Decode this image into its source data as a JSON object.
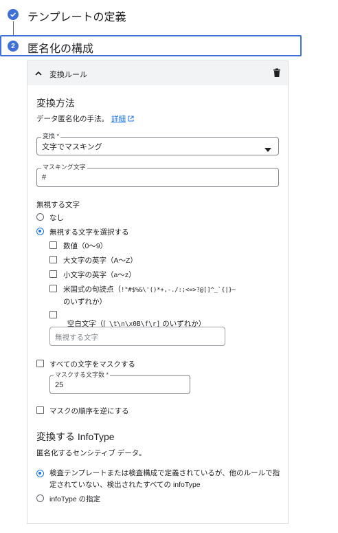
{
  "stepper": {
    "step1": {
      "title": "テンプレートの定義"
    },
    "step2": {
      "number": "2",
      "title": "匿名化の構成"
    }
  },
  "rule_card": {
    "header_label": "変換ルール",
    "transform_method": {
      "title": "変換方法",
      "description": "データ匿名化の手法。",
      "details_link": "詳細"
    },
    "transform_select": {
      "label": "変換 *",
      "value": "文字でマスキング"
    },
    "masking_char_field": {
      "label": "マスキング文字",
      "value": "#"
    },
    "ignore_chars": {
      "title": "無視する文字",
      "options": [
        {
          "label": "なし",
          "selected": false
        },
        {
          "label": "無視する文字を選択する",
          "selected": true
        }
      ],
      "checkboxes": [
        {
          "label": "数値（0〜9）",
          "checked": false
        },
        {
          "label": "大文字の英字（A〜Z）",
          "checked": false
        },
        {
          "label": "小文字の英字（a〜z）",
          "checked": false
        },
        {
          "label_prefix": "米国式の句読点（",
          "label_code": "!\"#$%&\\'()*+,-./:;<=>?@[]^_`{|}~",
          "label_suffix": "のいずれか）",
          "checked": false
        },
        {
          "label_prefix": "空白文字（[",
          "label_code": " \\t\\n\\x0B\\f\\r]",
          "label_suffix": " のいずれか）",
          "checked": false
        }
      ],
      "input_placeholder": "無視する文字"
    },
    "mask_all": {
      "label": "すべての文字をマスクする",
      "checked": false
    },
    "mask_count_field": {
      "label": "マスクする文字数 *",
      "value": "25"
    },
    "reverse_order": {
      "label": "マスクの順序を逆にする",
      "checked": false
    },
    "infotype": {
      "title": "変換する InfoType",
      "description": "匿名化するセンシティブ データ。",
      "options": [
        {
          "label": "検査テンプレートまたは検査構成で定義されているが、他のルールで指定されていない、検出されたすべての infoType",
          "selected": true
        },
        {
          "label": "infoType の指定",
          "selected": false
        }
      ]
    }
  },
  "colors": {
    "accent": "#1a73e8",
    "step_active": "#3f6fd8",
    "card_header_bg": "#f1f3f4",
    "border": "#dadce0"
  },
  "icons": {
    "step1": "check-circle-icon",
    "collapse": "chevron-up-icon",
    "delete": "trash-icon",
    "external_link": "external-link-icon",
    "dropdown": "caret-down-icon"
  }
}
